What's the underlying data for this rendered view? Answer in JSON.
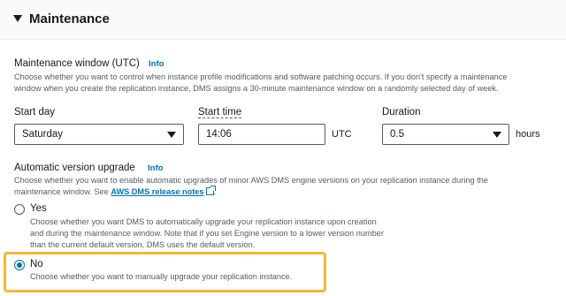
{
  "section": {
    "title": "Maintenance"
  },
  "maintenance_window": {
    "label": "Maintenance window (UTC)",
    "info": "Info",
    "description_line1": "Choose whether you want to control when instance profile modifications and software patching occurs. If you don't specify a maintenance",
    "description_line2": "window when you create the replication instance, DMS assigns a 30-minute maintenance window on a randomly selected day of week."
  },
  "start_day": {
    "label": "Start day",
    "value": "Saturday"
  },
  "start_time": {
    "label": "Start time",
    "value": "14:06",
    "unit": "UTC"
  },
  "duration": {
    "label": "Duration",
    "value": "0.5",
    "unit": "hours"
  },
  "auto_upgrade": {
    "label": "Automatic version upgrade",
    "info": "Info",
    "description_line1": "Choose whether you want to enable automatic upgrades of minor AWS DMS engine versions on your replication instance during the",
    "description_line2_prefix": "maintenance window. See ",
    "link_text": "AWS DMS release notes",
    "description_line2_suffix": ".",
    "options": [
      {
        "label": "Yes",
        "selected": false,
        "desc_line1": "Choose whether you want DMS to automatically upgrade your replication instance upon creation",
        "desc_line2": "and during the maintenance window. Note that if you set Engine version to a lower version number",
        "desc_line3": "than the current default version, DMS uses the default version."
      },
      {
        "label": "No",
        "selected": true,
        "desc_line1": "Choose whether you want to manually upgrade your replication instance."
      }
    ]
  },
  "colors": {
    "accent": "#0073bb",
    "highlight": "#f7b733"
  }
}
